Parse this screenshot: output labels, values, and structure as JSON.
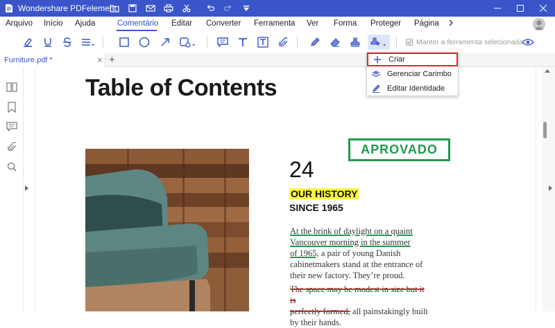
{
  "app": {
    "title": "Wondershare PDFelement"
  },
  "colors": {
    "titlebar": "#3a55c9",
    "accent": "#3a55c9",
    "stamp": "#1e9a4a",
    "highlight": "#fff73a",
    "strike": "#d42b2b",
    "focus_border": "#e2252b"
  },
  "menu": {
    "items": [
      {
        "label": "Arquivo"
      },
      {
        "label": "Início"
      },
      {
        "label": "Ajuda"
      },
      {
        "label": "Comentário",
        "active": true
      },
      {
        "label": "Editar"
      },
      {
        "label": "Converter"
      },
      {
        "label": "Ferramenta"
      },
      {
        "label": "Ver"
      },
      {
        "label": "Forma"
      },
      {
        "label": "Proteger"
      },
      {
        "label": "Página"
      }
    ],
    "more_icon": "chevron-right-icon"
  },
  "toolbar": {
    "keep_tool_label": "Manter a ferramenta selecionada",
    "keep_tool_checked": true,
    "icons": [
      "highlight-icon",
      "underline-icon",
      "strikethrough-icon",
      "text-lines-icon",
      "rectangle-icon",
      "ellipse-icon",
      "arrow-icon",
      "shape-options-icon",
      "note-icon",
      "text-icon",
      "textbox-icon",
      "attachment-icon",
      "pencil-icon",
      "eraser-icon",
      "stamp-icon",
      "stamp-menu-icon",
      "eye-icon"
    ]
  },
  "tabs": {
    "document": "Furniture.pdf *",
    "close": "×",
    "add": "+"
  },
  "stamp_menu": {
    "items": [
      {
        "label": "Criar",
        "icon": "plus-icon"
      },
      {
        "label": "Gerenciar Carimbo",
        "icon": "layers-icon"
      },
      {
        "label": "Editar Identidade",
        "icon": "edit-identity-icon"
      }
    ]
  },
  "document": {
    "heading": "Table of Contents",
    "stamp_text": "APROVADO",
    "number": "24",
    "history_title": "OUR HISTORY",
    "since": "SINCE 1965",
    "para1_underlined_1": "At the brink of daylight on a quaint",
    "para1_underlined_2": "Vancouver morning in the summer",
    "para1_underlined_3": "of 1965,",
    "para1_rest_3": " a pair of young Danish",
    "para1_line_4": "cabinetmakers stand at the entrance of",
    "para1_line_5": "their new factory. They’re proud.",
    "para2_strike_1": "The space may be modest in size but it is",
    "para2_strike_2": "perfectly formed,",
    "para2_rest_2": " all painstakingly built",
    "para2_line_3": "by their hands."
  }
}
